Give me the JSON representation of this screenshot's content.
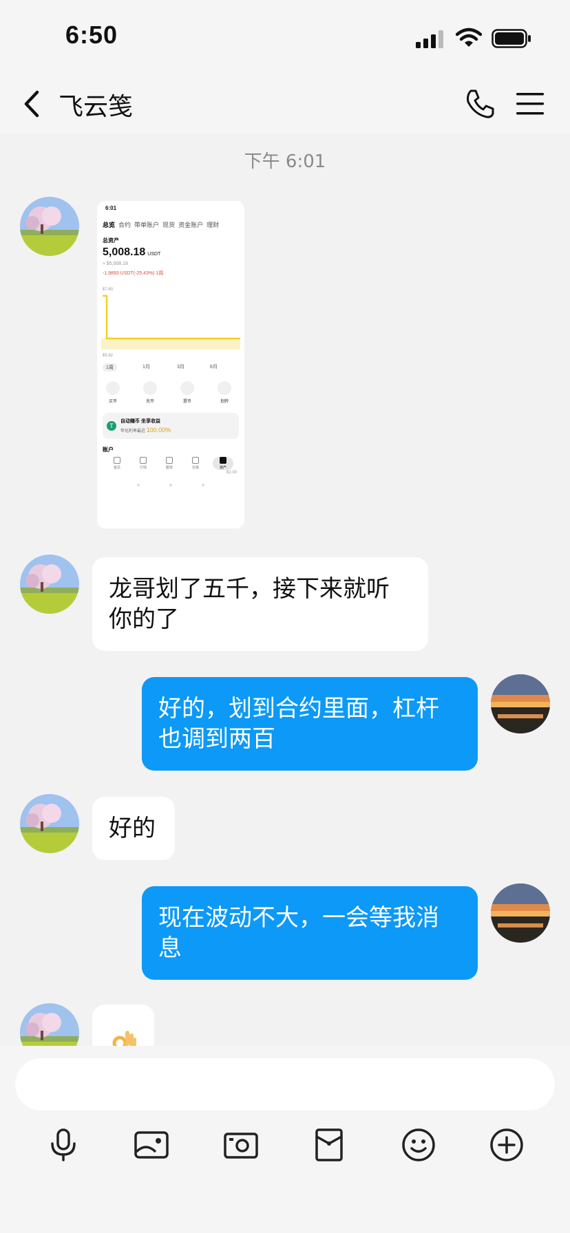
{
  "status_bar": {
    "time": "6:50"
  },
  "header": {
    "title": "飞云笺"
  },
  "chat": {
    "timestamp": "下午 6:01",
    "screenshot": {
      "time": "6:01",
      "tabs": [
        "总览",
        "合约",
        "带单账户",
        "现货",
        "资金账户",
        "理财"
      ],
      "total_assets_label": "总资产",
      "total_value": "5,008.18",
      "unit": "USDT",
      "approx_value": "≈ $5,008.18",
      "change": "-1.9893 USDT(-25.43%) 1周",
      "chart_high": "$7.60",
      "chart_low": "$5.82",
      "periods": [
        "1周",
        "1月",
        "3月",
        "6月"
      ],
      "actions": [
        "买币",
        "充币",
        "提币",
        "划转"
      ],
      "earn_title": "自动赚币 坐享收益",
      "earn_sub": "年化利率最近",
      "earn_rate": "100.00%",
      "account_label": "账户",
      "side_value": "$2.00",
      "bottom_nav": [
        "首页",
        "行情",
        "跟单",
        "交易",
        "资产"
      ]
    },
    "messages": [
      {
        "text": "龙哥划了五千，接下来就听你的了"
      },
      {
        "text": "好的，划到合约里面，杠杆也调到两百"
      },
      {
        "text": "好的"
      },
      {
        "text": "现在波动不大，一会等我消息"
      }
    ]
  },
  "composer": {
    "input_placeholder": "",
    "tools": [
      "microphone-icon",
      "image-icon",
      "camera-icon",
      "red-packet-icon",
      "emoji-icon",
      "plus-icon"
    ]
  },
  "colors": {
    "outgoing_bubble": "#0c99f7",
    "incoming_bubble": "#ffffff",
    "background": "#f2f2f2"
  }
}
